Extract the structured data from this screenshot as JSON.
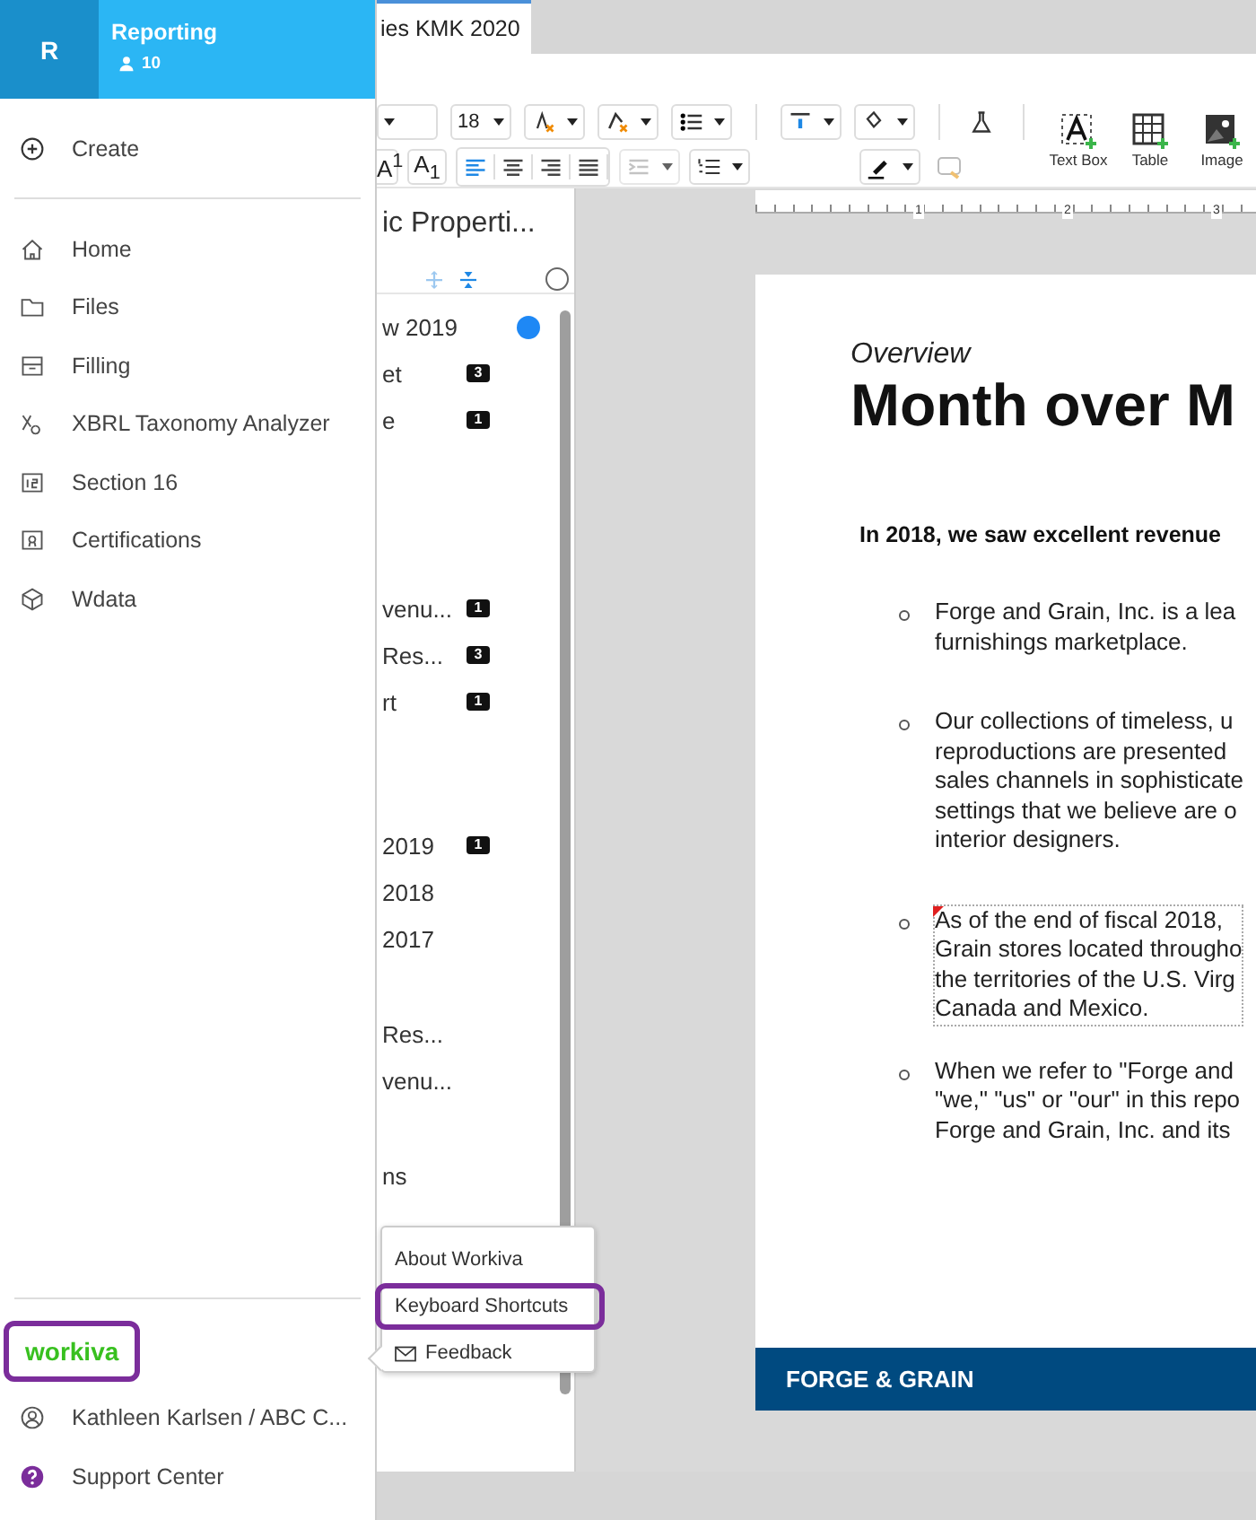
{
  "tab": {
    "label": "ies KMK 2020"
  },
  "toolbar": {
    "font_size": "18",
    "script_buttons": [
      "A$^{1}$",
      "A$_{1}$"
    ],
    "insert_buttons": [
      {
        "kind": "textbox",
        "label": "Text Box"
      },
      {
        "kind": "table",
        "label": "Table"
      },
      {
        "kind": "image",
        "label": "Image"
      }
    ]
  },
  "outline": {
    "title": "ic Properti...",
    "groups": [
      [
        {
          "label": "w 2019",
          "dot": true
        },
        {
          "label": "et",
          "dot": false,
          "comments": "3"
        },
        {
          "label": "e",
          "dot": false,
          "comments": "1"
        }
      ],
      [
        {
          "label": "venu...",
          "dot": false,
          "comments": "1"
        },
        {
          "label": "Res...",
          "dot": false,
          "comments": "3"
        },
        {
          "label": "rt",
          "dot": false,
          "comments": "1"
        }
      ],
      [
        {
          "label": "2019",
          "dot": false,
          "comments": "1"
        },
        {
          "label": "2018",
          "dot": false
        },
        {
          "label": "2017",
          "dot": false
        }
      ],
      [
        {
          "label": "Res...",
          "dot": false
        },
        {
          "label": "venu...",
          "dot": false
        }
      ],
      [
        {
          "label": "ns",
          "dot": false
        }
      ]
    ]
  },
  "ruler": {
    "labels": [
      "1",
      "2",
      "3"
    ]
  },
  "document": {
    "kicker": "Overview",
    "heading": "Month over M",
    "lead": "In 2018, we saw excellent revenue",
    "bullets": [
      {
        "lines": [
          "Forge and Grain, Inc. is a lea",
          "furnishings marketplace."
        ],
        "commented": false
      },
      {
        "lines": [
          "Our collections of timeless, u",
          "reproductions are presented",
          "sales channels in sophisticate",
          "settings that we believe are o",
          "interior designers."
        ],
        "commented": false
      },
      {
        "lines": [
          "As of the end of fiscal 2018,",
          "Grain stores located througho",
          "the territories of the U.S. Virg",
          "Canada and Mexico."
        ],
        "commented": true
      },
      {
        "lines": [
          "When we refer to \"Forge and",
          "\"we,\" \"us\" or \"our\" in this repo",
          "Forge and Grain, Inc. and its"
        ],
        "commented": false
      }
    ],
    "footer": "FORGE & GRAIN"
  },
  "sidebar": {
    "avatar": "R",
    "workspace": "Reporting",
    "members": "10",
    "create": "Create",
    "items": [
      {
        "kind": "home",
        "label": "Home"
      },
      {
        "kind": "files",
        "label": "Files"
      },
      {
        "kind": "filing",
        "label": "Filling"
      },
      {
        "kind": "xbrl",
        "label": "XBRL Taxonomy Analyzer"
      },
      {
        "kind": "section",
        "label": "Section 16"
      },
      {
        "kind": "cert",
        "label": "Certifications"
      },
      {
        "kind": "wdata",
        "label": "Wdata"
      }
    ],
    "logo": {
      "text": "workiva",
      "highlighted": true
    },
    "user": "Kathleen Karlsen / ABC C...",
    "support": "Support Center"
  },
  "help_menu": {
    "items": [
      {
        "kind": "text",
        "label": "About Workiva",
        "highlighted": false
      },
      {
        "kind": "text",
        "label": "Keyboard Shortcuts",
        "highlighted": true
      },
      {
        "kind": "mail",
        "label": "Feedback",
        "highlighted": false
      }
    ]
  }
}
